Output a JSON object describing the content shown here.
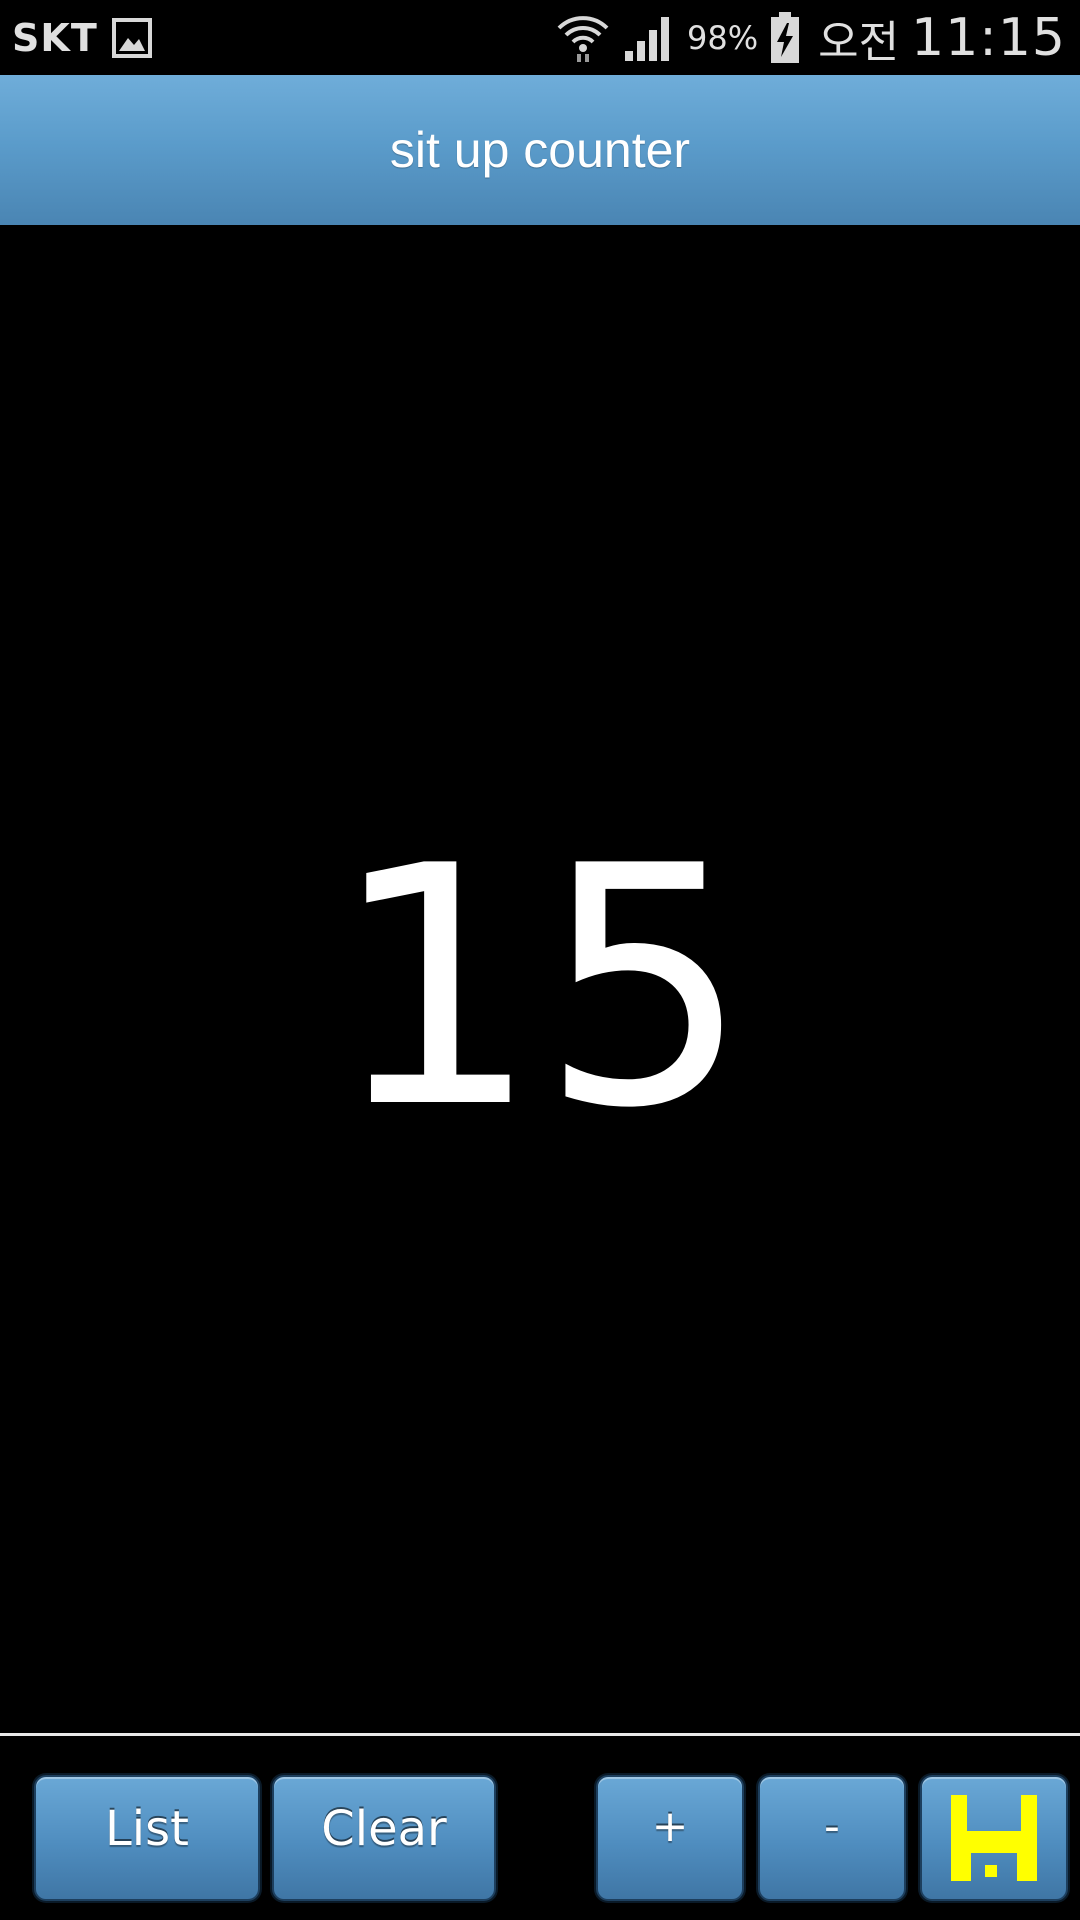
{
  "status_bar": {
    "carrier": "SKT",
    "notification_icon": "gallery-icon",
    "wifi_icon": "wifi-icon",
    "signal_icon": "signal-icon",
    "battery_percent": "98%",
    "battery_icon": "battery-charging-icon",
    "ampm": "오전",
    "time": "11:15"
  },
  "header": {
    "title": "sit up counter",
    "background_color": "#5b9ccb"
  },
  "counter": {
    "value": "15"
  },
  "toolbar": {
    "list_label": "List",
    "clear_label": "Clear",
    "increment_label": "+",
    "decrement_label": "-",
    "save_icon": "floppy-disk-icon",
    "save_icon_color": "#ffff00",
    "button_color": "#4f8dbf"
  }
}
